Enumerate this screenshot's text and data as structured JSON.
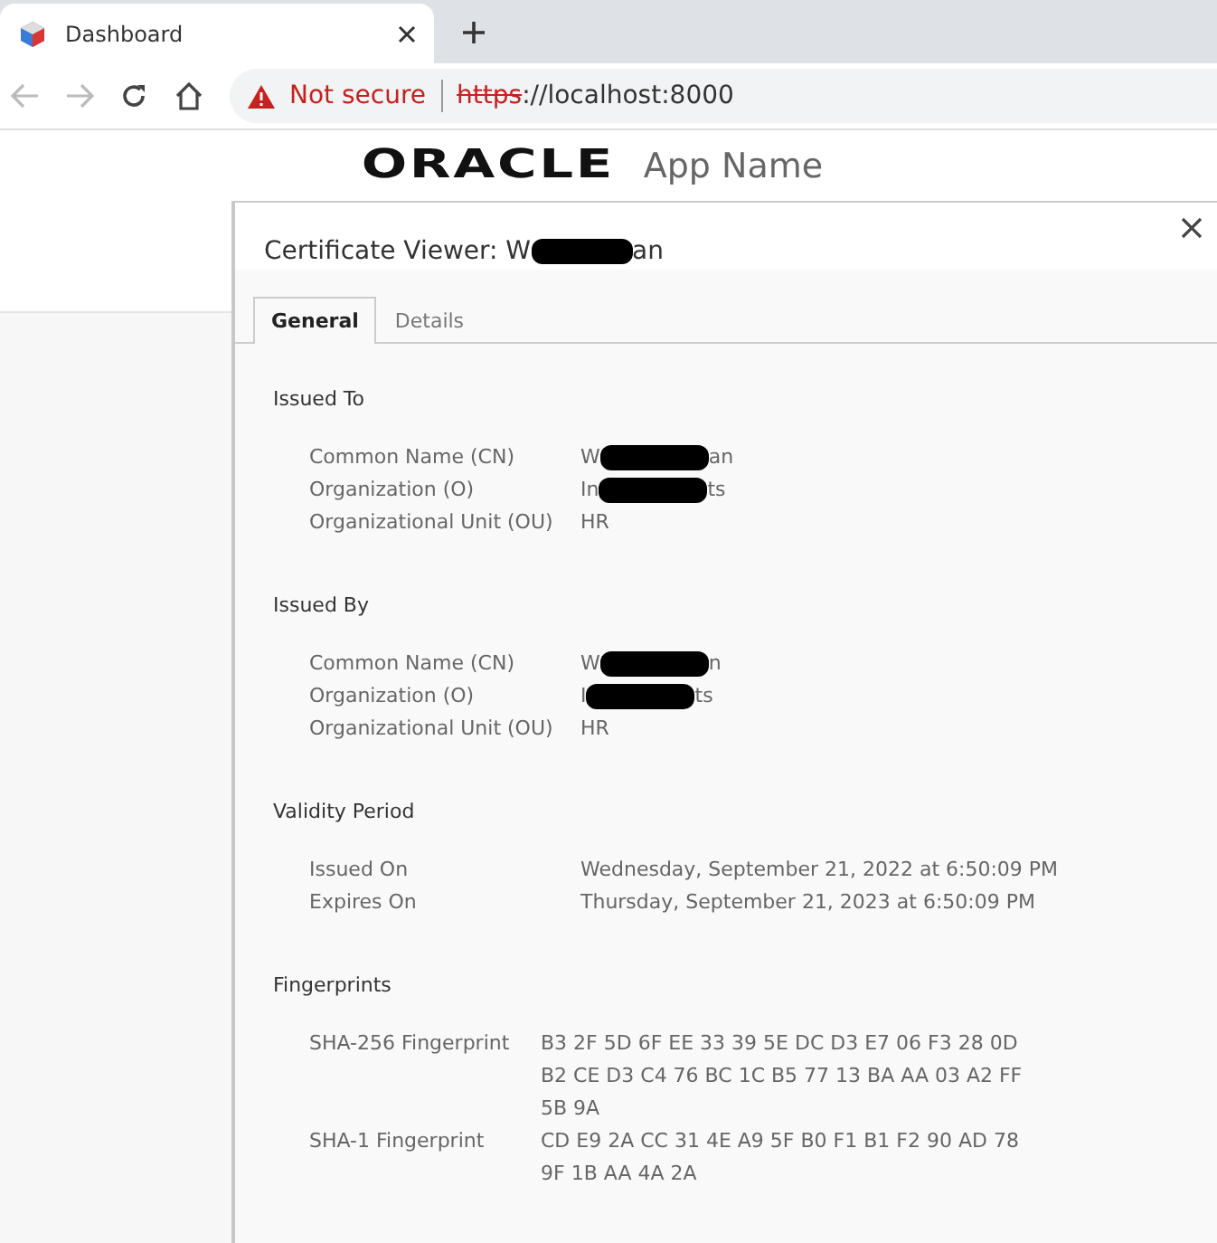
{
  "browser": {
    "tab": {
      "title": "Dashboard",
      "selected": true
    },
    "address": {
      "security": "Not secure",
      "scheme": "https",
      "rest": "://localhost:8000"
    }
  },
  "app_header": {
    "logo": "ORACLE",
    "app_name": "App Name"
  },
  "dialog": {
    "title_start": "Certificate Viewer: W",
    "title_end": "an",
    "tabs": [
      {
        "label": "General",
        "selected": true
      },
      {
        "label": "Details",
        "selected": false
      }
    ],
    "sections": [
      {
        "heading": "Issued To",
        "rows": [
          {
            "label": "Common Name (CN)",
            "value": "W",
            "value_end": "an",
            "redacted": true
          },
          {
            "label": "Organization (O)",
            "value": "In",
            "value_end": "ts",
            "redacted": true
          },
          {
            "label": "Organizational Unit (OU)",
            "value": "HR",
            "redacted": false
          }
        ]
      },
      {
        "heading": "Issued By",
        "rows": [
          {
            "label": "Common Name (CN)",
            "value": "W",
            "value_end": "n",
            "redacted": true
          },
          {
            "label": "Organization (O)",
            "value": "I",
            "value_end": "ts",
            "redacted": true
          },
          {
            "label": "Organizational Unit (OU)",
            "value": "HR",
            "redacted": false
          }
        ]
      },
      {
        "heading": "Validity Period",
        "rows": [
          {
            "label": "Issued On",
            "value": "Wednesday, September 21, 2022 at 6:50:09 PM",
            "redacted": false
          },
          {
            "label": "Expires On",
            "value": "Thursday, September 21, 2023 at 6:50:09 PM",
            "redacted": false
          }
        ]
      },
      {
        "heading": "Fingerprints",
        "kind": "fingerprint",
        "rows": [
          {
            "label": "SHA-256 Fingerprint",
            "value": "B3 2F 5D 6F EE 33 39 5E DC D3 E7 06 F3 28 0D B2 CE D3 C4 76 BC 1C B5 77 13 BA AA 03 A2 FF 5B 9A",
            "redacted": false
          },
          {
            "label": "SHA-1 Fingerprint",
            "value": "CD E9 2A CC 31 4E A9 5F B0 F1 B1 F2 90 AD 78 9F 1B AA 4A 2A",
            "redacted": false
          }
        ]
      }
    ]
  }
}
